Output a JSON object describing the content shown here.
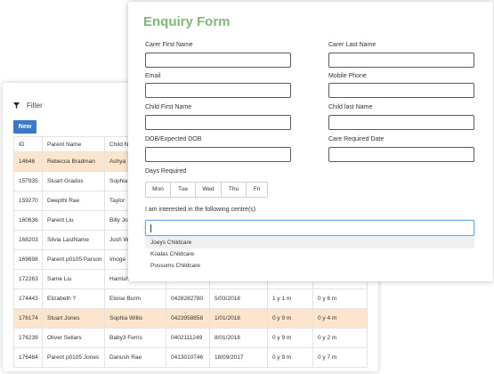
{
  "table_panel": {
    "filter_label": "Filter",
    "new_button": "New",
    "columns": [
      "ID",
      "Parent Name",
      "Child N"
    ],
    "rows": [
      {
        "id": "14646",
        "parent": "Rebecca Bradman",
        "child": "Ashya",
        "phone": "",
        "date": "",
        "age1": "",
        "age2": "",
        "highlight": true
      },
      {
        "id": "157935",
        "parent": "Stuart Grados",
        "child": "Sophia",
        "phone": "",
        "date": "",
        "age1": "",
        "age2": "",
        "highlight": false
      },
      {
        "id": "159270",
        "parent": "Deepthi Rae",
        "child": "Taylor",
        "phone": "",
        "date": "",
        "age1": "",
        "age2": "",
        "highlight": false
      },
      {
        "id": "160636",
        "parent": "Parent Liu",
        "child": "Billy Jo",
        "phone": "",
        "date": "",
        "age1": "",
        "age2": "",
        "highlight": false
      },
      {
        "id": "168203",
        "parent": "Silvia LastName",
        "child": "Josh W",
        "phone": "",
        "date": "",
        "age1": "",
        "age2": "",
        "highlight": false
      },
      {
        "id": "169698",
        "parent": "Parent p0105 Parson",
        "child": "Imoge",
        "phone": "",
        "date": "",
        "age1": "",
        "age2": "",
        "highlight": false
      },
      {
        "id": "172263",
        "parent": "Same Liu",
        "child": "Hamish",
        "phone": "",
        "date": "",
        "age1": "",
        "age2": "",
        "highlight": false
      },
      {
        "id": "174443",
        "parent": "Elizabeth ?",
        "child": "Eloise Burm",
        "phone": "0428282780",
        "date": "5/03/2018",
        "age1": "1 y 1 m",
        "age2": "0 y 6 m",
        "highlight": false
      },
      {
        "id": "176174",
        "parent": "Stuart Jones",
        "child": "Sophia Willis",
        "phone": "0423958858",
        "date": "1/01/2018",
        "age1": "0 y 9 m",
        "age2": "0 y 4 m",
        "highlight": true
      },
      {
        "id": "176239",
        "parent": "Oliver Sellars",
        "child": "Baby3 Ferris",
        "phone": "0402111249",
        "date": "8/01/2018",
        "age1": "0 y 9 m",
        "age2": "0 y 2 m",
        "highlight": false
      },
      {
        "id": "176484",
        "parent": "Parent p0105 Jones",
        "child": "Danush Rae",
        "phone": "0413010746",
        "date": "18/09/2017",
        "age1": "0 y 9 m",
        "age2": "0 y 7 m",
        "highlight": false
      }
    ]
  },
  "form": {
    "title": "Enquiry Form",
    "carer_first_name": "Carer First Name",
    "carer_last_name": "Carer Last Name",
    "email": "Email",
    "mobile_phone": "Mobile Phone",
    "child_first_name": "Child First Name",
    "child_last_name": "Child last Name",
    "dob": "DOB/Expected DOB",
    "care_required_date": "Care Required Date",
    "days_required": "Days Required",
    "days": [
      "Mon",
      "Tue",
      "Wed",
      "Thu",
      "Fri"
    ],
    "centre_label": "I am interested in the following centre(s)",
    "centre_options": [
      "Joeys Childcare",
      "Koalas Childcare",
      "Possums Childcare"
    ]
  },
  "colors": {
    "title_green": "#7fb87b",
    "button_blue": "#3c78c8",
    "row_highlight": "#fde4cc",
    "focus_border": "#68a6e8"
  },
  "icons": {
    "filter": "filter-icon"
  }
}
